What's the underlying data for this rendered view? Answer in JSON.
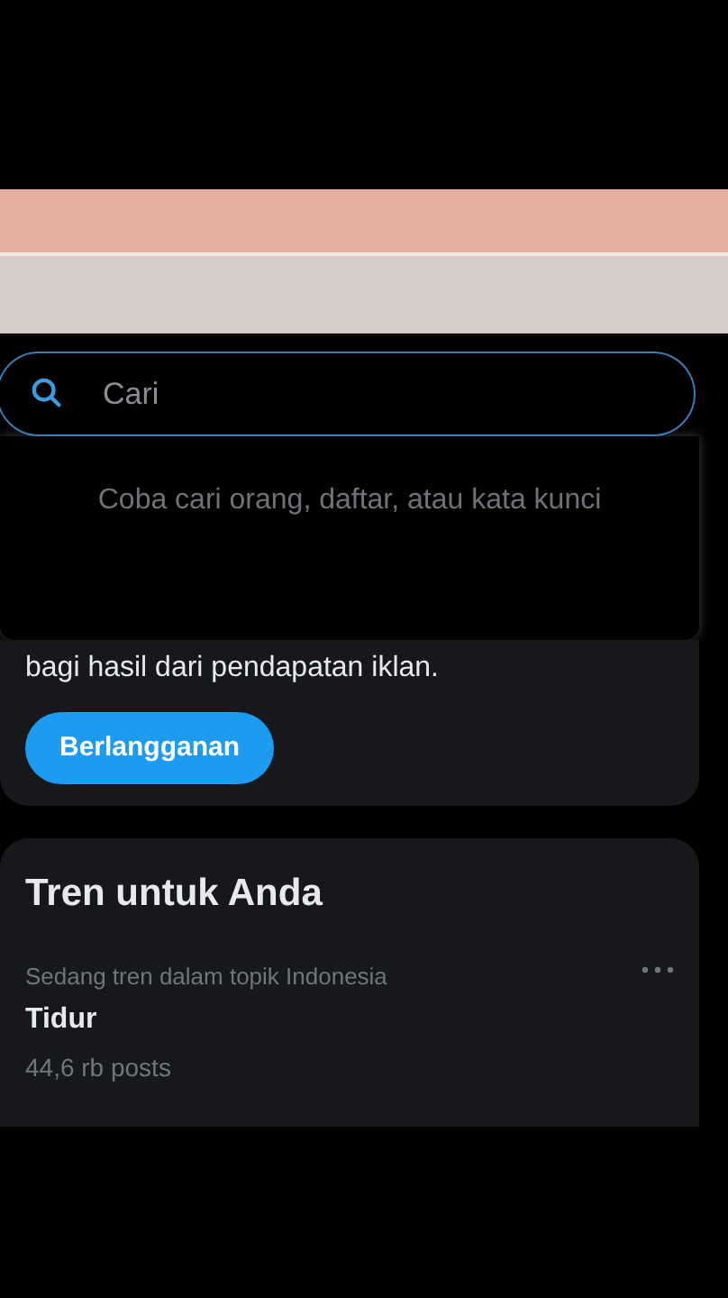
{
  "search": {
    "placeholder": "Cari",
    "hint": "Coba cari orang, daftar, atau kata kunci"
  },
  "premium_card": {
    "text": "bagi hasil dari pendapatan iklan.",
    "button": "Berlangganan"
  },
  "trends": {
    "title": "Tren untuk Anda",
    "items": [
      {
        "context": "Sedang tren dalam topik Indonesia",
        "topic": "Tidur",
        "count": "44,6 rb posts"
      }
    ]
  }
}
